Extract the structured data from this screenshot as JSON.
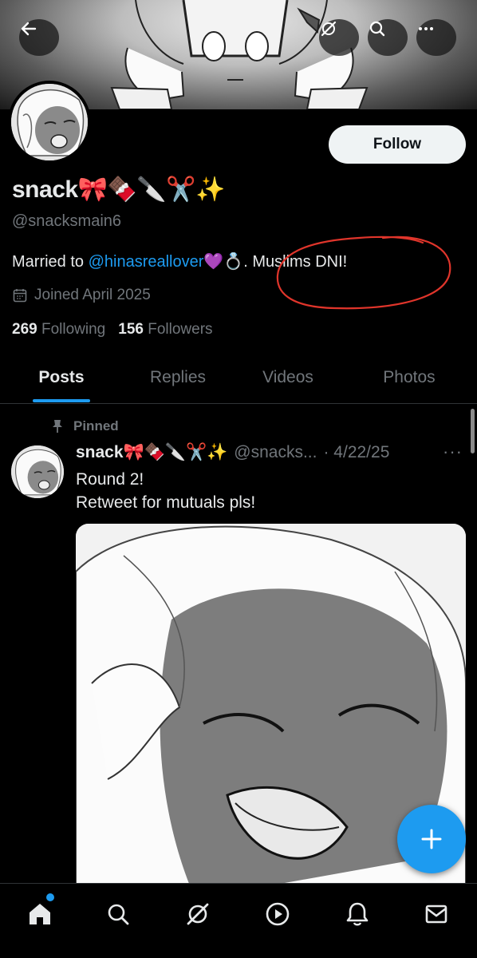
{
  "profile": {
    "name": "snack🎀🍫🔪✂️✨",
    "handle": "@snacksmain6",
    "bio_prefix": "Married to ",
    "bio_mention": "@hinasreallover",
    "bio_suffix": "💜💍. Muslims DNI!",
    "joined": "Joined April 2025",
    "following_count": "269",
    "following_label": "Following",
    "followers_count": "156",
    "followers_label": "Followers"
  },
  "header": {
    "follow_label": "Follow"
  },
  "tabs": [
    {
      "label": "Posts",
      "active": true
    },
    {
      "label": "Replies",
      "active": false
    },
    {
      "label": "Videos",
      "active": false
    },
    {
      "label": "Photos",
      "active": false
    }
  ],
  "post": {
    "pinned_label": "Pinned",
    "author_name": "snack🎀🍫🔪✂️✨",
    "author_handle": "@snacks...",
    "date": "· 4/22/25",
    "line1": "Round 2!",
    "line2": "Retweet for mutuals pls!",
    "more": "···"
  },
  "icons": {
    "back": "arrow-left-icon",
    "grok": "grok-icon",
    "search": "search-icon",
    "more": "more-icon",
    "calendar": "calendar-icon",
    "pin": "pin-icon",
    "compose": "plus-icon",
    "home": "home-icon",
    "explore": "search-icon",
    "grok_nav": "grok-icon",
    "video": "play-icon",
    "notifications": "bell-icon",
    "messages": "mail-icon"
  },
  "colors": {
    "accent": "#1d9bf0",
    "annotation": "#e0352b",
    "background": "#000000"
  }
}
